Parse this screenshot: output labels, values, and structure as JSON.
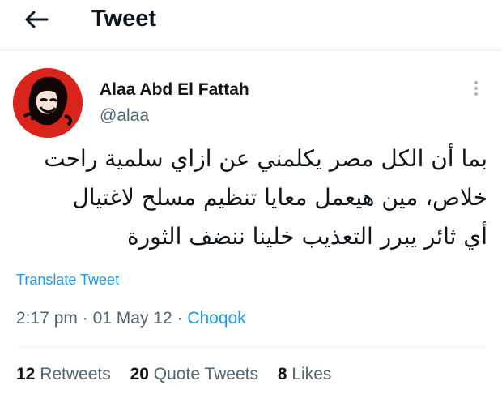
{
  "header": {
    "title": "Tweet",
    "back_icon": "arrow-left-icon"
  },
  "author": {
    "name": "Alaa Abd El Fattah",
    "handle": "@alaa",
    "avatar_color": "#d9241c"
  },
  "tweet": {
    "lines": [
      "بما أن الكل مصر يكلمني عن ازاي سلمية راحت",
      "خلاص، مين هيعمل معايا تنظيم مسلح لاغتيال",
      "أي ثائر يبرر التعذيب خلينا ننضف الثورة"
    ]
  },
  "translate_label": "Translate Tweet",
  "meta": {
    "time": "2:17 pm",
    "sep": "·",
    "date": "01 May 12",
    "source": "Choqok"
  },
  "stats": {
    "retweets_count": "12",
    "retweets_label": "Retweets",
    "quotes_count": "20",
    "quotes_label": "Quote Tweets",
    "likes_count": "8",
    "likes_label": "Likes"
  },
  "colors": {
    "accent": "#1d9bf0",
    "secondary_text": "#536471",
    "primary_text": "#0f1419"
  }
}
